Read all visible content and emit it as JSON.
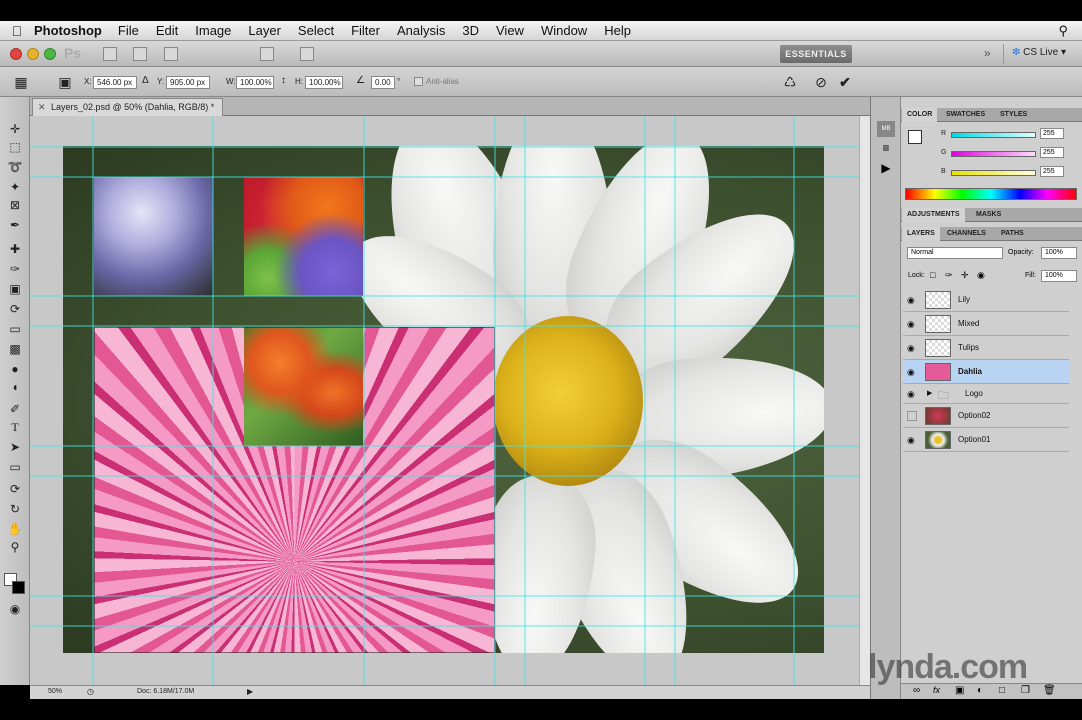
{
  "menubar": {
    "apple_icon": "apple-icon",
    "app_name": "Photoshop",
    "items": [
      "File",
      "Edit",
      "Image",
      "Layer",
      "Select",
      "Filter",
      "Analysis",
      "3D",
      "View",
      "Window",
      "Help"
    ],
    "spotlight_icon": "search-icon"
  },
  "appbar": {
    "logo": "Ps",
    "workspace": "ESSENTIALS",
    "chevron": "»",
    "cslive": "CS Live"
  },
  "options": {
    "x_label": "X:",
    "x_value": "546.00 px",
    "y_label": "Y:",
    "y_value": "905.00 px",
    "w_label": "W:",
    "w_value": "100.00%",
    "h_label": "H:",
    "h_value": "100.00%",
    "angle_value": "0.00",
    "degree_mark": "°",
    "antialias_label": "Anti-alias"
  },
  "document": {
    "tab_title": "Layers_02.psd @ 50% (Dahlia, RGB/8) *",
    "zoom": "50%",
    "doc_size": "Doc: 6.18M/17.0M"
  },
  "color_panel": {
    "tabs": [
      "COLOR",
      "SWATCHES",
      "STYLES"
    ],
    "channels": [
      {
        "label": "R",
        "value": "255",
        "color": "#00d8e8"
      },
      {
        "label": "G",
        "value": "255",
        "color": "#e000e0"
      },
      {
        "label": "B",
        "value": "255",
        "color": "#e8e000"
      }
    ]
  },
  "adjustments_panel": {
    "tabs": [
      "ADJUSTMENTS",
      "MASKS"
    ]
  },
  "layers_panel": {
    "tabs": [
      "LAYERS",
      "CHANNELS",
      "PATHS"
    ],
    "blend_mode": "Normal",
    "opacity_label": "Opacity:",
    "opacity_value": "100%",
    "lock_label": "Lock:",
    "fill_label": "Fill:",
    "fill_value": "100%",
    "layers": [
      {
        "name": "Lily",
        "visible": true,
        "selected": false
      },
      {
        "name": "Mixed",
        "visible": true,
        "selected": false
      },
      {
        "name": "Tulips",
        "visible": true,
        "selected": false
      },
      {
        "name": "Dahlia",
        "visible": true,
        "selected": true
      },
      {
        "name": "Logo",
        "visible": true,
        "selected": false,
        "group": true
      },
      {
        "name": "Option02",
        "visible": false,
        "selected": false
      },
      {
        "name": "Option01",
        "visible": true,
        "selected": false
      }
    ]
  },
  "watermark": "lynda.com",
  "colors": {
    "guide": "#3ee6e6",
    "selected_layer": "#b9d3f3",
    "workspace_bg": "#c8c8c8"
  }
}
